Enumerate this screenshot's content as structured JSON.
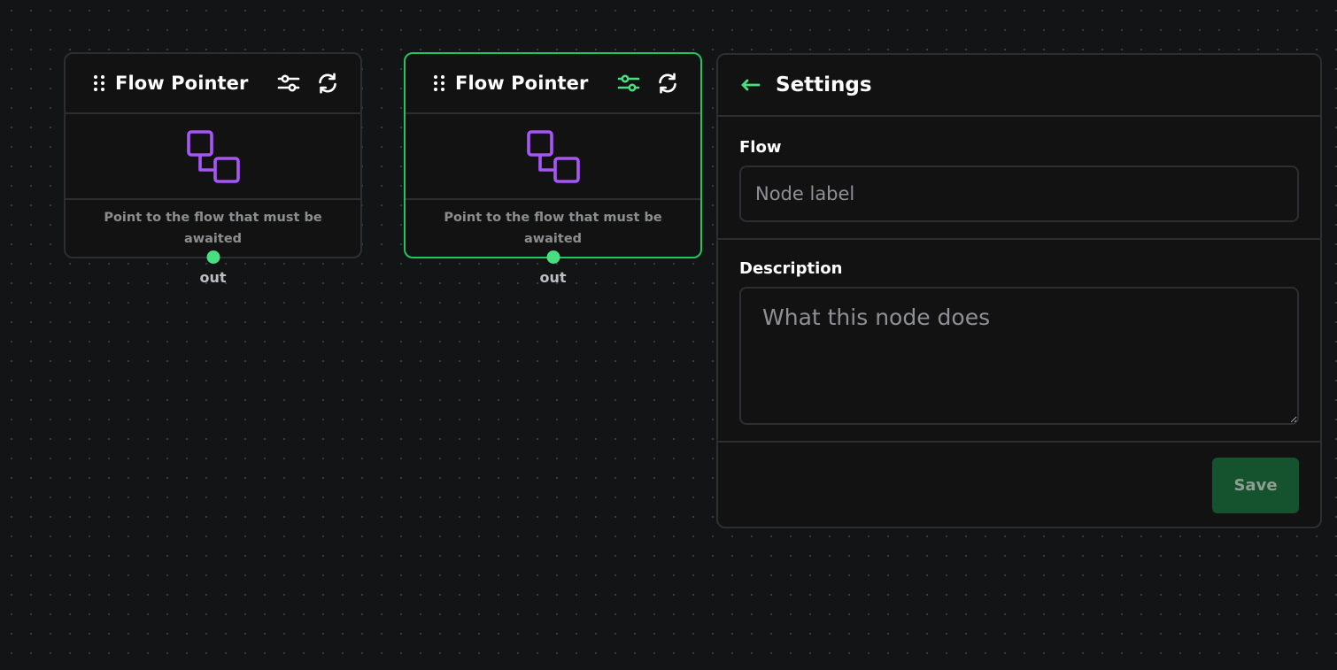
{
  "canvas": {
    "nodes": [
      {
        "title": "Flow Pointer",
        "description": "Point to the flow that must be awaited",
        "handle_label": "out",
        "selected": false
      },
      {
        "title": "Flow Pointer",
        "description": "Point to the flow that must be awaited",
        "handle_label": "out",
        "selected": true
      }
    ]
  },
  "settings": {
    "title": "Settings",
    "flow_label": "Flow",
    "flow_placeholder": "Node label",
    "flow_value": "",
    "description_label": "Description",
    "description_placeholder": "What this node does",
    "description_value": "",
    "save_label": "Save"
  },
  "icons": {
    "drag": "drag-handle-icon",
    "settings": "sliders-icon",
    "refresh": "refresh-icon",
    "flow": "flow-link-icon",
    "back": "arrow-left-icon"
  },
  "colors": {
    "accent_green": "#22c55e",
    "handle_green": "#4ade80",
    "flow_icon_purple": "#a855f7",
    "save_bg": "#14532d"
  }
}
